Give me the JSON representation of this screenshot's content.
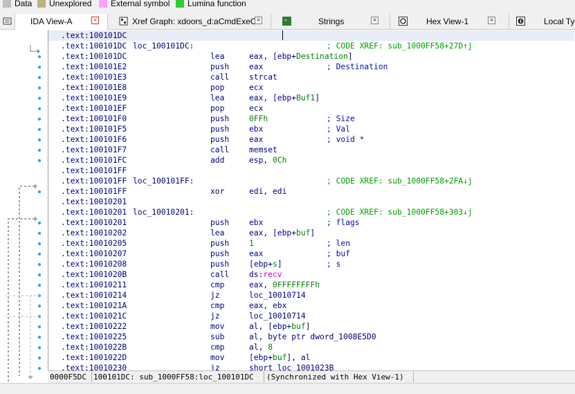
{
  "legend": [
    {
      "label": "Data",
      "color": "#c0c0c0"
    },
    {
      "label": "Unexplored",
      "color": "#bab27a"
    },
    {
      "label": "External symbol",
      "color": "#ffa0ff"
    },
    {
      "label": "Lumina function",
      "color": "#33cc33"
    }
  ],
  "tabs": [
    {
      "label": "IDA View-A",
      "icon": "ida-view-icon",
      "active": true
    },
    {
      "label": "Xref Graph: xdoors_d:aCmdExeC",
      "icon": "graph-icon",
      "active": false
    },
    {
      "label": "Strings",
      "icon": "strings-icon",
      "active": false
    },
    {
      "label": "Hex View-1",
      "icon": "hex-view-icon",
      "active": false
    },
    {
      "label": "Local Typ",
      "icon": "local-types-icon",
      "active": false
    }
  ],
  "lines": [
    {
      "addr": ".text:100101DC",
      "label": "",
      "mn": "",
      "op": "",
      "cmt": ""
    },
    {
      "addr": ".text:100101DC",
      "label": "loc_100101DC:",
      "mn": "",
      "op": "",
      "cmt": "; CODE XREF: sub_1000FF58+27D↑j"
    },
    {
      "addr": ".text:100101DC",
      "label": "",
      "mn": "lea",
      "op": "eax, [ebp+Destination]",
      "cmt": ""
    },
    {
      "addr": ".text:100101E2",
      "label": "",
      "mn": "push",
      "op": "eax",
      "cmt": "; Destination"
    },
    {
      "addr": ".text:100101E3",
      "label": "",
      "mn": "call",
      "op": "strcat",
      "cmt": ""
    },
    {
      "addr": ".text:100101E8",
      "label": "",
      "mn": "pop",
      "op": "ecx",
      "cmt": ""
    },
    {
      "addr": ".text:100101E9",
      "label": "",
      "mn": "lea",
      "op": "eax, [ebp+Buf1]",
      "cmt": ""
    },
    {
      "addr": ".text:100101EF",
      "label": "",
      "mn": "pop",
      "op": "ecx",
      "cmt": ""
    },
    {
      "addr": ".text:100101F0",
      "label": "",
      "mn": "push",
      "op": "0FFh",
      "cmt": "; Size"
    },
    {
      "addr": ".text:100101F5",
      "label": "",
      "mn": "push",
      "op": "ebx",
      "cmt": "; Val"
    },
    {
      "addr": ".text:100101F6",
      "label": "",
      "mn": "push",
      "op": "eax",
      "cmt": "; void *"
    },
    {
      "addr": ".text:100101F7",
      "label": "",
      "mn": "call",
      "op": "memset",
      "cmt": ""
    },
    {
      "addr": ".text:100101FC",
      "label": "",
      "mn": "add",
      "op": "esp, 0Ch",
      "cmt": ""
    },
    {
      "addr": ".text:100101FF",
      "label": "",
      "mn": "",
      "op": "",
      "cmt": ""
    },
    {
      "addr": ".text:100101FF",
      "label": "loc_100101FF:",
      "mn": "",
      "op": "",
      "cmt": "; CODE XREF: sub_1000FF58+2FA↓j"
    },
    {
      "addr": ".text:100101FF",
      "label": "",
      "mn": "xor",
      "op": "edi, edi",
      "cmt": ""
    },
    {
      "addr": ".text:10010201",
      "label": "",
      "mn": "",
      "op": "",
      "cmt": ""
    },
    {
      "addr": ".text:10010201",
      "label": "loc_10010201:",
      "mn": "",
      "op": "",
      "cmt": "; CODE XREF: sub_1000FF58+303↓j"
    },
    {
      "addr": ".text:10010201",
      "label": "",
      "mn": "push",
      "op": "ebx",
      "cmt": "; flags"
    },
    {
      "addr": ".text:10010202",
      "label": "",
      "mn": "lea",
      "op": "eax, [ebp+buf]",
      "cmt": ""
    },
    {
      "addr": ".text:10010205",
      "label": "",
      "mn": "push",
      "op": "1",
      "cmt": "; len"
    },
    {
      "addr": ".text:10010207",
      "label": "",
      "mn": "push",
      "op": "eax",
      "cmt": "; buf"
    },
    {
      "addr": ".text:10010208",
      "label": "",
      "mn": "push",
      "op": "[ebp+s]",
      "cmt": "; s"
    },
    {
      "addr": ".text:1001020B",
      "label": "",
      "mn": "call",
      "op": "ds:recv",
      "cmt": ""
    },
    {
      "addr": ".text:10010211",
      "label": "",
      "mn": "cmp",
      "op": "eax, 0FFFFFFFFh",
      "cmt": ""
    },
    {
      "addr": ".text:10010214",
      "label": "",
      "mn": "jz",
      "op": "loc_10010714",
      "cmt": ""
    },
    {
      "addr": ".text:1001021A",
      "label": "",
      "mn": "cmp",
      "op": "eax, ebx",
      "cmt": ""
    },
    {
      "addr": ".text:1001021C",
      "label": "",
      "mn": "jz",
      "op": "loc_10010714",
      "cmt": ""
    },
    {
      "addr": ".text:10010222",
      "label": "",
      "mn": "mov",
      "op": "al, [ebp+buf]",
      "cmt": ""
    },
    {
      "addr": ".text:10010225",
      "label": "",
      "mn": "sub",
      "op": "al, byte ptr dword_1008E5D0",
      "cmt": ""
    },
    {
      "addr": ".text:1001022B",
      "label": "",
      "mn": "cmp",
      "op": "al, 8",
      "cmt": ""
    },
    {
      "addr": ".text:1001022D",
      "label": "",
      "mn": "mov",
      "op": "[ebp+buf], al",
      "cmt": ""
    },
    {
      "addr": ".text:10010230",
      "label": "",
      "mn": "jz",
      "op": "short loc_1001023B",
      "cmt": ""
    }
  ],
  "status": {
    "offset": "0000F5DC",
    "location": "100101DC: sub_1000FF58:loc_100101DC",
    "sync": "(Synchronized with Hex View-1)"
  },
  "colors": {
    "address": "#000080",
    "xref_comment": "#00a000",
    "var_name": "#008000",
    "import": "#d000d0",
    "current_line": "#e8ecf6"
  }
}
